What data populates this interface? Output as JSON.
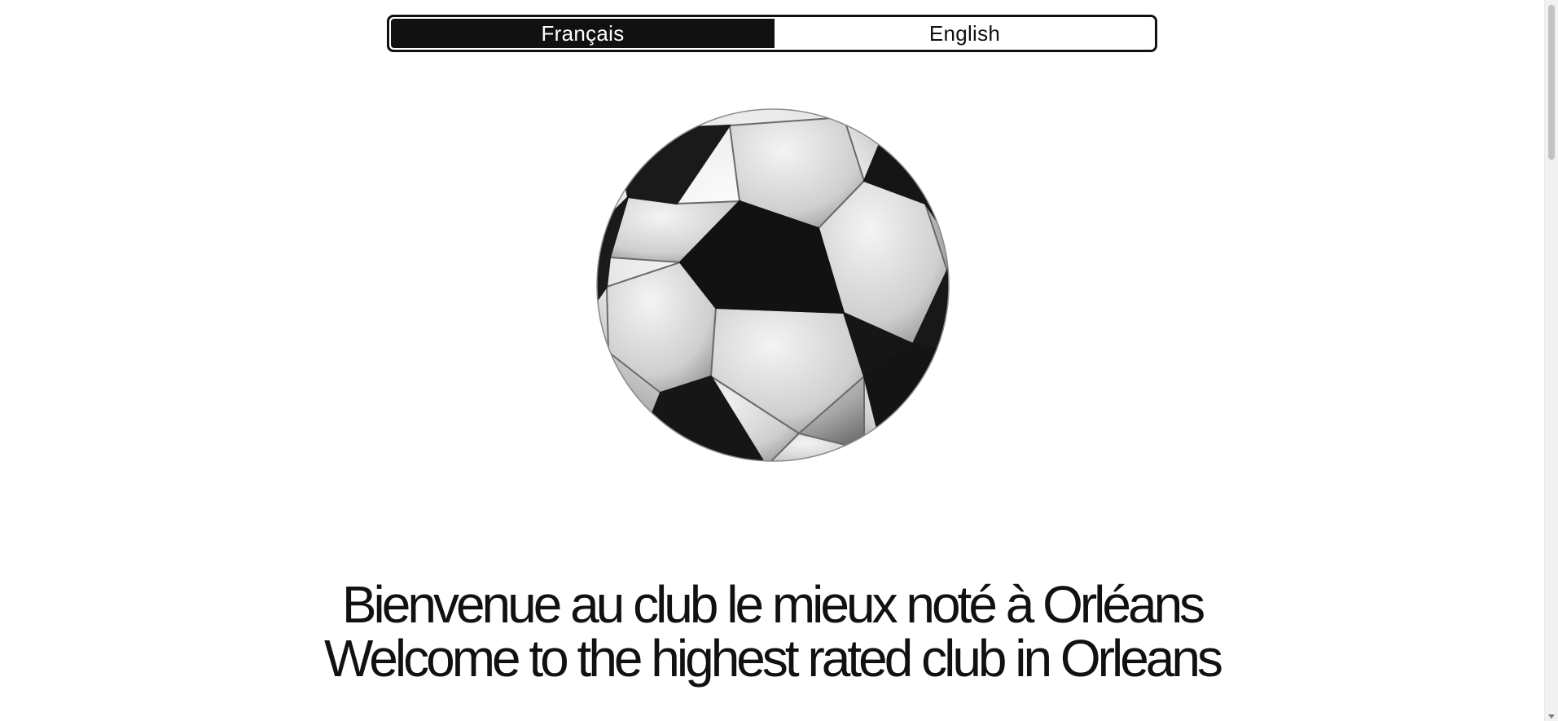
{
  "language_toggle": {
    "options": [
      {
        "label": "Français",
        "selected": true
      },
      {
        "label": "English",
        "selected": false
      }
    ]
  },
  "hero": {
    "image": "soccer-ball",
    "headline_fr": "Bienvenue au club le mieux noté à Orléans",
    "headline_en": "Welcome to the highest rated club in Orleans"
  },
  "colors": {
    "background": "#ffffff",
    "text": "#111111",
    "toggle_active_bg": "#111111",
    "toggle_active_text": "#ffffff"
  }
}
